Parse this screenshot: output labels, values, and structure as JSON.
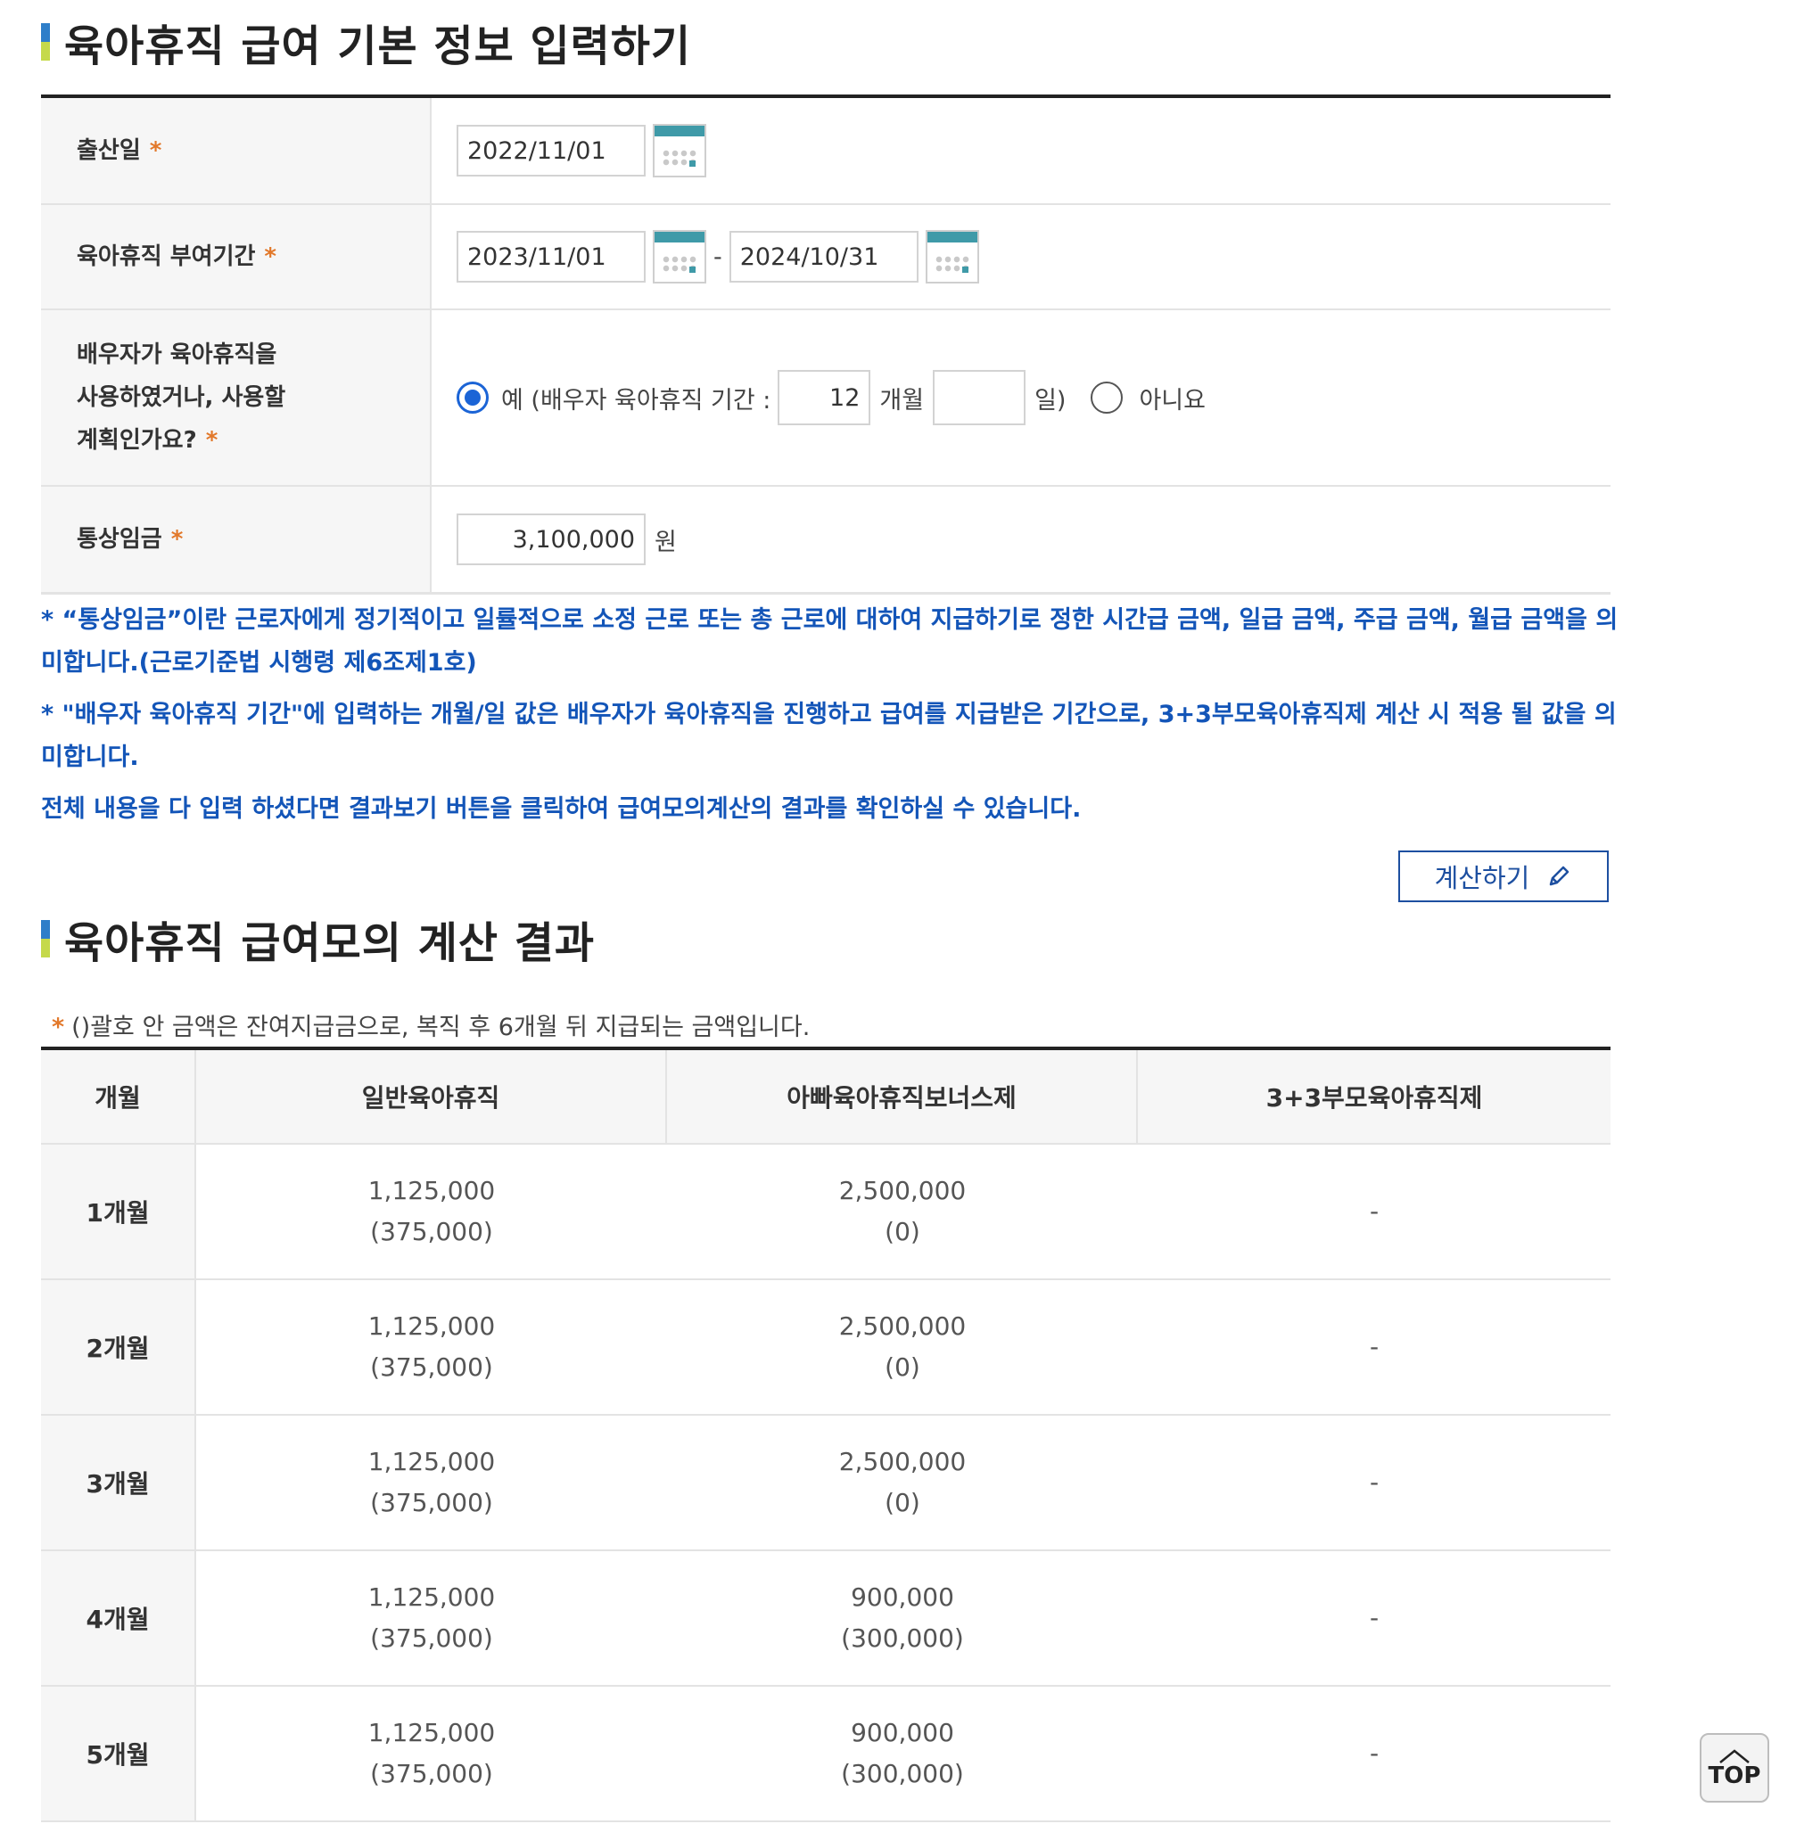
{
  "section1": {
    "title": "육아휴직 급여 기본 정보 입력하기"
  },
  "form": {
    "birth_label": "출산일",
    "birth_date": "2022/11/01",
    "period_label": "육아휴직 부여기간",
    "period_start": "2023/11/01",
    "period_sep": "-",
    "period_end": "2024/10/31",
    "spouse_label_line1": "배우자가 육아휴직을",
    "spouse_label_line2": "사용하였거나, 사용할",
    "spouse_label_line3": "계획인가요?",
    "spouse_yes_label": "예 (배우자 육아휴직 기간 :",
    "spouse_months": "12",
    "months_unit": "개월",
    "spouse_days": "",
    "days_unit": "일)",
    "spouse_no_label": "아니요",
    "wage_label": "통상임금",
    "wage_value": "3,100,000",
    "wage_unit": "원",
    "required_mark": "*"
  },
  "notes": [
    "* “통상임금”이란 근로자에게 정기적이고 일률적으로 소정 근로 또는 총 근로에 대하여 지급하기로 정한 시간급 금액, 일급 금액, 주급 금액, 월급 금액을 의미합니다.(근로기준법 시행령 제6조제1호)",
    "* \"배우자 육아휴직 기간\"에 입력하는 개월/일 값은 배우자가 육아휴직을 진행하고 급여를 지급받은 기간으로, 3+3부모육아휴직제 계산 시 적용 될 값을 의미합니다.",
    "전체 내용을 다 입력 하셨다면 결과보기 버튼을 클릭하여 급여모의계산의 결과를 확인하실 수 있습니다."
  ],
  "calc_button": "계산하기",
  "section2": {
    "title": "육아휴직 급여모의 계산 결과"
  },
  "result_note_mark": "*",
  "result_note": "()괄호 안 금액은 잔여지급금으로, 복직 후 6개월 뒤 지급되는 금액입니다.",
  "table": {
    "headers": [
      "개월",
      "일반육아휴직",
      "아빠육아휴직보너스제",
      "3+3부모육아휴직제"
    ],
    "rows": [
      {
        "month": "1개월",
        "general": "1,125,000",
        "general_rem": "(375,000)",
        "bonus": "2,500,000",
        "bonus_rem": "(0)",
        "parent": "-"
      },
      {
        "month": "2개월",
        "general": "1,125,000",
        "general_rem": "(375,000)",
        "bonus": "2,500,000",
        "bonus_rem": "(0)",
        "parent": "-"
      },
      {
        "month": "3개월",
        "general": "1,125,000",
        "general_rem": "(375,000)",
        "bonus": "2,500,000",
        "bonus_rem": "(0)",
        "parent": "-"
      },
      {
        "month": "4개월",
        "general": "1,125,000",
        "general_rem": "(375,000)",
        "bonus": "900,000",
        "bonus_rem": "(300,000)",
        "parent": "-"
      },
      {
        "month": "5개월",
        "general": "1,125,000",
        "general_rem": "(375,000)",
        "bonus": "900,000",
        "bonus_rem": "(300,000)",
        "parent": "-"
      }
    ]
  },
  "top_button": "TOP"
}
